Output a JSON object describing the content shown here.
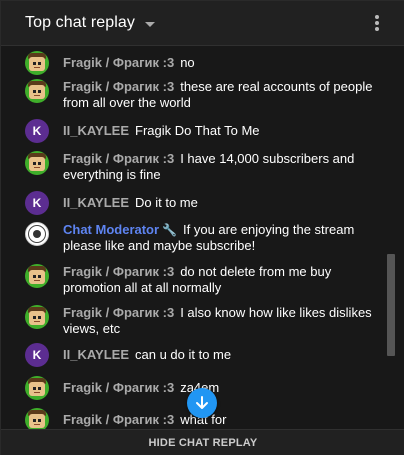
{
  "header": {
    "title": "Top chat replay"
  },
  "messages": [
    {
      "author": "Fragik / Фрагик :3",
      "text": "no",
      "avatar": "fragik"
    },
    {
      "author": "Fragik / Фрагик :3",
      "text": "these are real accounts of people from all over the world",
      "avatar": "fragik"
    },
    {
      "author": "II_KAYLEE",
      "text": "Fragik Do That To Me",
      "avatar": "k"
    },
    {
      "author": "Fragik / Фрагик :3",
      "text": "I have 14,000 subscribers and everything is fine",
      "avatar": "fragik"
    },
    {
      "author": "II_KAYLEE",
      "text": "Do it to me",
      "avatar": "k"
    },
    {
      "author": "Chat Moderator",
      "text": "If you are enjoying the stream please like and maybe subscribe!",
      "avatar": "mod",
      "moderator": true
    },
    {
      "author": "Fragik / Фрагик :3",
      "text": "do not delete from me buy promotion all at all normally",
      "avatar": "fragik"
    },
    {
      "author": "Fragik / Фрагик :3",
      "text": "I also know how like likes dislikes views, etc",
      "avatar": "fragik"
    },
    {
      "author": "II_KAYLEE",
      "text": "can u do it to me",
      "avatar": "k"
    },
    {
      "author": "Fragik / Фрагик :3",
      "text": "za4em",
      "avatar": "fragik"
    },
    {
      "author": "Fragik / Фрагик :3",
      "text": "what for",
      "avatar": "fragik"
    }
  ],
  "avatar_letter": "K",
  "footer": {
    "hide_label": "HIDE CHAT REPLAY"
  },
  "icons": {
    "caret": "caret-down-icon",
    "menu": "more-vert-icon",
    "scroll": "arrow-down-icon",
    "moderator": "wrench-icon"
  },
  "colors": {
    "background": "#181818",
    "header": "#212121",
    "author": "#aaaaaa",
    "moderator": "#5e84f1",
    "scroll_button": "#2196f3",
    "avatar_purple": "#5c2d91",
    "avatar_green": "#3fae2a"
  }
}
